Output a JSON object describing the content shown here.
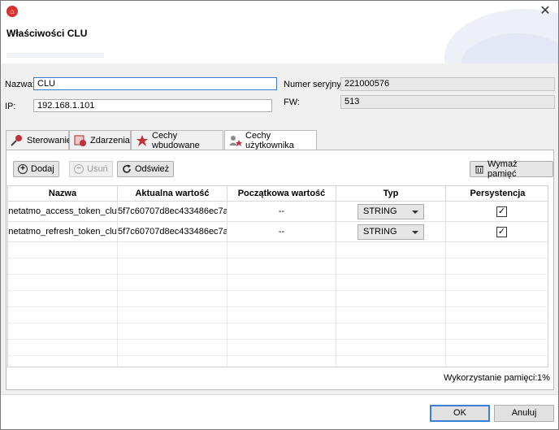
{
  "window": {
    "title": "Właściwości CLU",
    "close_glyph": "✕"
  },
  "form": {
    "name_label": "Nazwa:",
    "name_value": "CLU",
    "ip_label": "IP:",
    "ip_value": "192.168.1.101",
    "serial_label": "Numer seryjny:",
    "serial_value": "221000576",
    "fw_label": "FW:",
    "fw_value": "513"
  },
  "tabs": [
    {
      "label": "Sterowanie",
      "icon": "control-icon",
      "active": false
    },
    {
      "label": "Zdarzenia",
      "icon": "events-icon",
      "active": false
    },
    {
      "label": "Cechy wbudowane",
      "icon": "builtin-features-icon",
      "active": false
    },
    {
      "label": "Cechy użytkownika",
      "icon": "user-features-icon",
      "active": true
    }
  ],
  "toolbar": {
    "add_label": "Dodaj",
    "remove_label": "Usuń",
    "refresh_label": "Odśwież",
    "clear_memory_label": "Wymaż pamięć"
  },
  "table": {
    "columns": [
      "Nazwa",
      "Aktualna wartość",
      "Początkowa wartość",
      "Typ",
      "Persystencja"
    ],
    "rows": [
      {
        "name": "netatmo_access_token_clu",
        "current": "5f7c60707d8ec433486ec7a...",
        "initial": "--",
        "type": "STRING",
        "persistent": true
      },
      {
        "name": "netatmo_refresh_token_clu",
        "current": "5f7c60707d8ec433486ec7a...",
        "initial": "--",
        "type": "STRING",
        "persistent": true
      }
    ]
  },
  "memory": {
    "label": "Wykorzystanie pamięci:",
    "value": "1%"
  },
  "footer": {
    "ok_label": "OK",
    "cancel_label": "Anuluj"
  }
}
